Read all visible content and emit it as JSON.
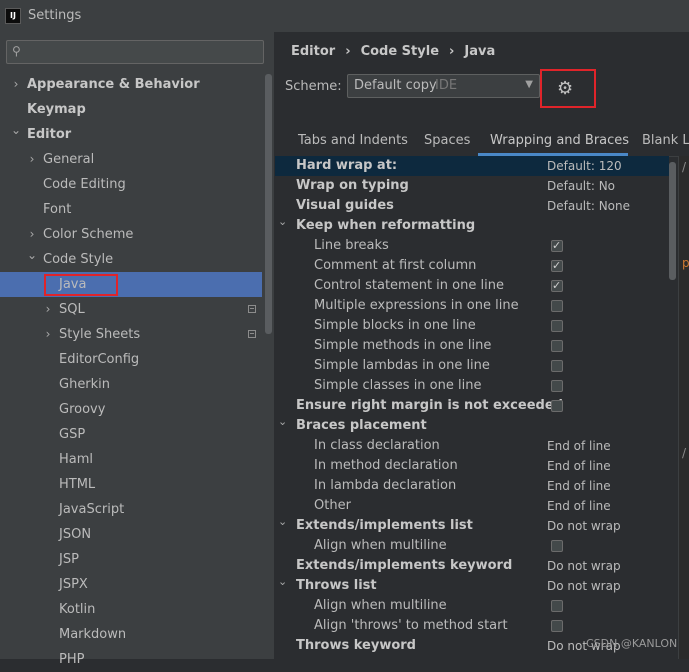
{
  "window": {
    "title": "Settings",
    "logo": "IJ"
  },
  "sidebar": {
    "search": {
      "placeholder": "",
      "value": ""
    },
    "items": [
      {
        "label": "Appearance & Behavior",
        "level": 0,
        "chevron": "right",
        "bold": true
      },
      {
        "label": "Keymap",
        "level": 0,
        "chevron": "",
        "bold": true
      },
      {
        "label": "Editor",
        "level": 0,
        "chevron": "down",
        "bold": true
      },
      {
        "label": "General",
        "level": 1,
        "chevron": "right"
      },
      {
        "label": "Code Editing",
        "level": 1,
        "chevron": ""
      },
      {
        "label": "Font",
        "level": 1,
        "chevron": ""
      },
      {
        "label": "Color Scheme",
        "level": 1,
        "chevron": "right"
      },
      {
        "label": "Code Style",
        "level": 1,
        "chevron": "down"
      },
      {
        "label": "Java",
        "level": 2,
        "chevron": "",
        "selected": true
      },
      {
        "label": "SQL",
        "level": 2,
        "chevron": "right",
        "mini": true
      },
      {
        "label": "Style Sheets",
        "level": 2,
        "chevron": "right",
        "mini": true
      },
      {
        "label": "EditorConfig",
        "level": 2,
        "chevron": ""
      },
      {
        "label": "Gherkin",
        "level": 2,
        "chevron": ""
      },
      {
        "label": "Groovy",
        "level": 2,
        "chevron": ""
      },
      {
        "label": "GSP",
        "level": 2,
        "chevron": ""
      },
      {
        "label": "Haml",
        "level": 2,
        "chevron": ""
      },
      {
        "label": "HTML",
        "level": 2,
        "chevron": ""
      },
      {
        "label": "JavaScript",
        "level": 2,
        "chevron": ""
      },
      {
        "label": "JSON",
        "level": 2,
        "chevron": ""
      },
      {
        "label": "JSP",
        "level": 2,
        "chevron": ""
      },
      {
        "label": "JSPX",
        "level": 2,
        "chevron": ""
      },
      {
        "label": "Kotlin",
        "level": 2,
        "chevron": ""
      },
      {
        "label": "Markdown",
        "level": 2,
        "chevron": ""
      },
      {
        "label": "PHP",
        "level": 2,
        "chevron": ""
      }
    ]
  },
  "breadcrumb": [
    "Editor",
    "›",
    "Code Style",
    "›",
    "Java"
  ],
  "scheme": {
    "label": "Scheme:",
    "value": "Default copy",
    "tag": "IDE",
    "gear_icon": "gear-icon"
  },
  "tabs": [
    "Tabs and Indents",
    "Spaces",
    "Wrapping and Braces",
    "Blank Lin"
  ],
  "active_tab": "Wrapping and Braces",
  "options": [
    {
      "label": "Hard wrap at:",
      "bold": true,
      "value": "Default: 120",
      "highlight": true
    },
    {
      "label": "Wrap on typing",
      "bold": true,
      "value": "Default: No"
    },
    {
      "label": "Visual guides",
      "bold": true,
      "value": "Default: None"
    },
    {
      "label": "Keep when reformatting",
      "bold": true,
      "chevron": true
    },
    {
      "label": "Line breaks",
      "indent": true,
      "checkbox": true,
      "checked": true
    },
    {
      "label": "Comment at first column",
      "indent": true,
      "checkbox": true,
      "checked": true
    },
    {
      "label": "Control statement in one line",
      "indent": true,
      "checkbox": true,
      "checked": true
    },
    {
      "label": "Multiple expressions in one line",
      "indent": true,
      "checkbox": true,
      "checked": false
    },
    {
      "label": "Simple blocks in one line",
      "indent": true,
      "checkbox": true,
      "checked": false
    },
    {
      "label": "Simple methods in one line",
      "indent": true,
      "checkbox": true,
      "checked": false
    },
    {
      "label": "Simple lambdas in one line",
      "indent": true,
      "checkbox": true,
      "checked": false
    },
    {
      "label": "Simple classes in one line",
      "indent": true,
      "checkbox": true,
      "checked": false
    },
    {
      "label": "Ensure right margin is not exceeded",
      "bold": true,
      "checkbox": true,
      "checked": false
    },
    {
      "label": "Braces placement",
      "bold": true,
      "chevron": true
    },
    {
      "label": "In class declaration",
      "indent": true,
      "value": "End of line"
    },
    {
      "label": "In method declaration",
      "indent": true,
      "value": "End of line"
    },
    {
      "label": "In lambda declaration",
      "indent": true,
      "value": "End of line"
    },
    {
      "label": "Other",
      "indent": true,
      "value": "End of line"
    },
    {
      "label": "Extends/implements list",
      "bold": true,
      "chevron": true,
      "value": "Do not wrap"
    },
    {
      "label": "Align when multiline",
      "indent": true,
      "checkbox": true,
      "checked": false
    },
    {
      "label": "Extends/implements keyword",
      "bold": true,
      "value": "Do not wrap"
    },
    {
      "label": "Throws list",
      "bold": true,
      "chevron": true,
      "value": "Do not wrap"
    },
    {
      "label": "Align when multiline",
      "indent": true,
      "checkbox": true,
      "checked": false
    },
    {
      "label": "Align 'throws' to method start",
      "indent": true,
      "checkbox": true,
      "checked": false
    },
    {
      "label": "Throws keyword",
      "bold": true,
      "value": "Do not wrap"
    }
  ],
  "preview_glyphs": [
    "/",
    "p",
    "/"
  ],
  "watermark": "CSDN @KANLON",
  "colors": {
    "selection": "#4b6eaf",
    "highlight_row": "#0d293e",
    "annotation_red": "#e0242a",
    "tab_underline": "#4a88c7"
  }
}
